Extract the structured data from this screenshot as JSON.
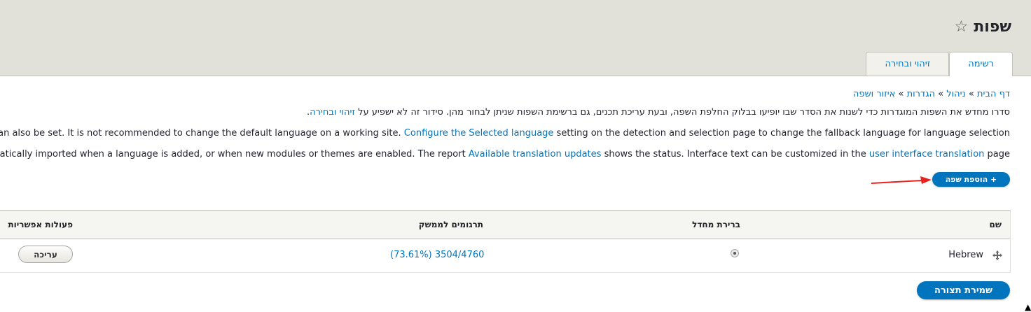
{
  "header": {
    "title": "שפות",
    "star_icon": "star-outline-icon",
    "tabs": [
      {
        "label": "רשימה",
        "active": true
      },
      {
        "label": "זיהוי ובחירה",
        "active": false
      }
    ]
  },
  "breadcrumb": {
    "items": [
      "דף הבית",
      "ניהול",
      "הגדרות",
      "איזור ושפה"
    ],
    "separator": "»"
  },
  "description": {
    "hebrew_text": "סדרו מחדש את השפות המוגדרות כדי לשנות את הסדר שבו יופיעו בבלוק החלפת השפה, ובעת עריכת תכנים, גם ברשימת השפות שניתן לבחור מהן. סידור זה לא ישפיע על ",
    "hebrew_link": "זיהוי ובחירה",
    "hebrew_end": ".",
    "en1_before": "an also be set. It is not recommended to change the default language on a working site. ",
    "en1_link": "Configure the Selected language",
    "en1_after": " setting on the detection and selection page to change the fallback language for language selection",
    "en2_before": "atically imported when a language is added, or when new modules or themes are enabled. The report ",
    "en2_link1": "Available translation updates",
    "en2_middle": " shows the status. Interface text can be customized in the ",
    "en2_link2": "user interface translation",
    "en2_after": " page"
  },
  "add_language_button": "+ הוספת שפה",
  "table": {
    "headers": {
      "name": "שם",
      "default": "ברירת מחדל",
      "translations": "תרגומים לממשק",
      "operations": "פעולות אפשריות"
    },
    "rows": [
      {
        "name": "Hebrew",
        "default_selected": true,
        "translations": "(73.61%) 3504/4760",
        "edit_label": "עריכה"
      }
    ]
  },
  "save_button": "שמירת תצורה",
  "colors": {
    "accent": "#0074bd",
    "header_bg": "#e1e0d9"
  }
}
